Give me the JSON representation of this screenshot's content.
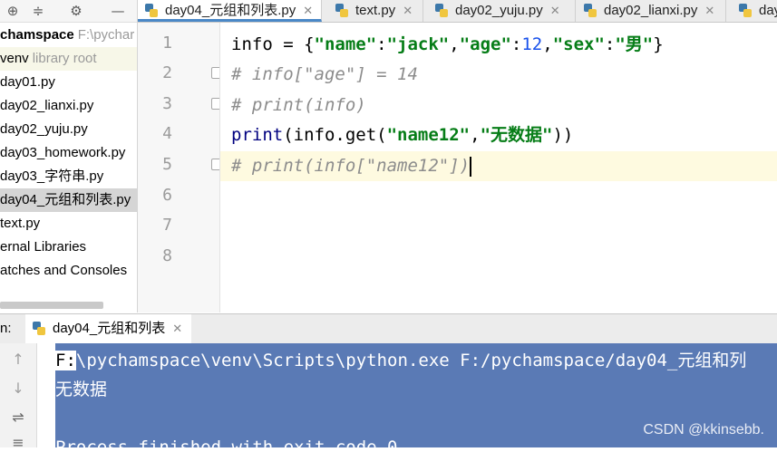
{
  "sidebar": {
    "toolbar_icons": [
      "target-icon",
      "collapse-icon",
      "gear-icon"
    ],
    "items": [
      {
        "label": "chamspace",
        "muted": "F:\\pychar",
        "kind": "root"
      },
      {
        "label": "venv",
        "muted": "library root",
        "kind": "venv"
      },
      {
        "label": "day01.py",
        "muted": "",
        "kind": "file"
      },
      {
        "label": "day02_lianxi.py",
        "muted": "",
        "kind": "file"
      },
      {
        "label": "day02_yuju.py",
        "muted": "",
        "kind": "file"
      },
      {
        "label": "day03_homework.py",
        "muted": "",
        "kind": "file"
      },
      {
        "label": "day03_字符串.py",
        "muted": "",
        "kind": "file"
      },
      {
        "label": "day04_元组和列表.py",
        "muted": "",
        "kind": "selected"
      },
      {
        "label": "text.py",
        "muted": "",
        "kind": "file"
      },
      {
        "label": "ernal Libraries",
        "muted": "",
        "kind": "file"
      },
      {
        "label": "atches and Consoles",
        "muted": "",
        "kind": "file"
      }
    ]
  },
  "editor_tabs": [
    {
      "label": "day04_元组和列表.py",
      "active": true
    },
    {
      "label": "text.py",
      "active": false
    },
    {
      "label": "day02_yuju.py",
      "active": false
    },
    {
      "label": "day02_lianxi.py",
      "active": false
    },
    {
      "label": "day",
      "active": false
    }
  ],
  "editor": {
    "line_numbers": [
      "1",
      "2",
      "3",
      "4",
      "5",
      "6",
      "7",
      "8"
    ],
    "lines": {
      "l1": {
        "a": "info = {",
        "s1": "\"name\"",
        "c1": ":",
        "s2": "\"jack\"",
        "c2": ",",
        "s3": "\"age\"",
        "c3": ":",
        "n1": "12",
        "c4": ",",
        "s4": "\"sex\"",
        "c5": ":",
        "s5": "\"男\"",
        "e": "}"
      },
      "l2": "# info[\"age\"] = 14",
      "l3": "# print(info)",
      "l4": {
        "fn": "print",
        "a": "(info.get(",
        "s1": "\"name12\"",
        "c1": ",",
        "s2": "\"无数据\"",
        "e": "))"
      },
      "l5": "# print(info[\"name12\"])"
    }
  },
  "run": {
    "label": "n:",
    "tab_label": "day04_元组和列表",
    "console": {
      "line1_prefix": "F:",
      "line1_rest": "\\pychamspace\\venv\\Scripts\\python.exe F:/pychamspace/day04_元组和列",
      "line2": "无数据",
      "line3": "Process finished with exit code 0"
    }
  },
  "watermark": "CSDN @kkinsebb.",
  "colors": {
    "string": "#067d17",
    "number": "#1750eb",
    "comment": "#8c8c8c",
    "selection": "#5a7ab5"
  }
}
